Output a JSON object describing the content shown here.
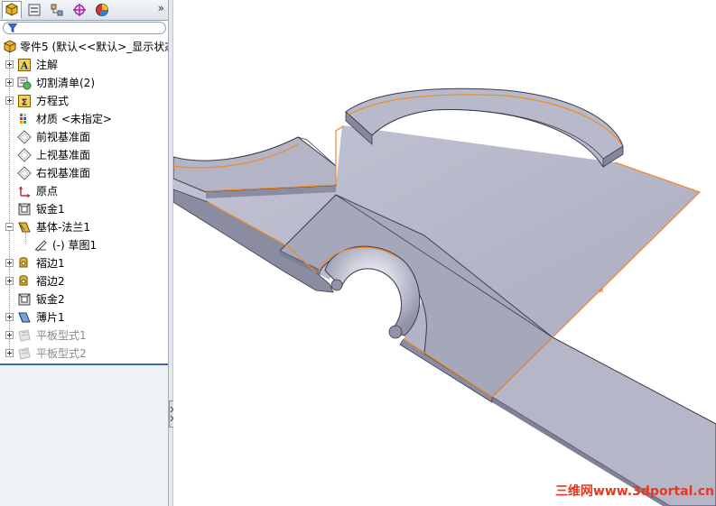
{
  "tabs": [
    {
      "name": "featuremanager-tab",
      "icon": "featuremanager-tree-icon"
    },
    {
      "name": "propertymanager-tab",
      "icon": "propertymanager-icon"
    },
    {
      "name": "configurationmanager-tab",
      "icon": "configuration-icon"
    },
    {
      "name": "dimxpert-tab",
      "icon": "dimxpert-target-icon"
    },
    {
      "name": "display-manager-tab",
      "icon": "display-pie-icon"
    }
  ],
  "more_label": "»",
  "tree": {
    "root_label": "零件5 (默认<<默认>_显示状态",
    "items": [
      {
        "label": "注解",
        "icon": "annotation-icon",
        "expandable": true
      },
      {
        "label": "切割清单(2)",
        "icon": "cut-list-icon",
        "expandable": true
      },
      {
        "label": "方程式",
        "icon": "equation-icon",
        "expandable": true
      },
      {
        "label": "材质 <未指定>",
        "icon": "material-icon",
        "expandable": false
      },
      {
        "label": "前视基准面",
        "icon": "plane-icon",
        "expandable": false
      },
      {
        "label": "上视基准面",
        "icon": "plane-icon",
        "expandable": false
      },
      {
        "label": "右视基准面",
        "icon": "plane-icon",
        "expandable": false
      },
      {
        "label": "原点",
        "icon": "origin-icon",
        "expandable": false
      },
      {
        "label": "钣金1",
        "icon": "sheet-metal-icon",
        "expandable": false
      },
      {
        "label": "基体-法兰1",
        "icon": "base-flange-icon",
        "expandable": true,
        "expanded": true
      },
      {
        "label": "(-) 草图1",
        "icon": "sketch-icon",
        "expandable": false,
        "child": true
      },
      {
        "label": "褶边1",
        "icon": "hem-icon",
        "expandable": true
      },
      {
        "label": "褶边2",
        "icon": "hem-icon",
        "expandable": true
      },
      {
        "label": "钣金2",
        "icon": "sheet-metal-icon",
        "expandable": false
      },
      {
        "label": "薄片1",
        "icon": "tab-feature-icon",
        "expandable": true
      },
      {
        "label": "平板型式1",
        "icon": "flat-pattern-icon",
        "expandable": true,
        "dim": true
      },
      {
        "label": "平板型式2",
        "icon": "flat-pattern-icon",
        "expandable": true,
        "dim": true
      }
    ]
  },
  "watermark": "三维网www.3dportal.cn",
  "colors": {
    "part_face": "#9a9db2",
    "part_top": "#b3b5c6",
    "part_edge": "#3a3a4a",
    "selection": "#f08a24",
    "accent": "#3a66b0"
  }
}
